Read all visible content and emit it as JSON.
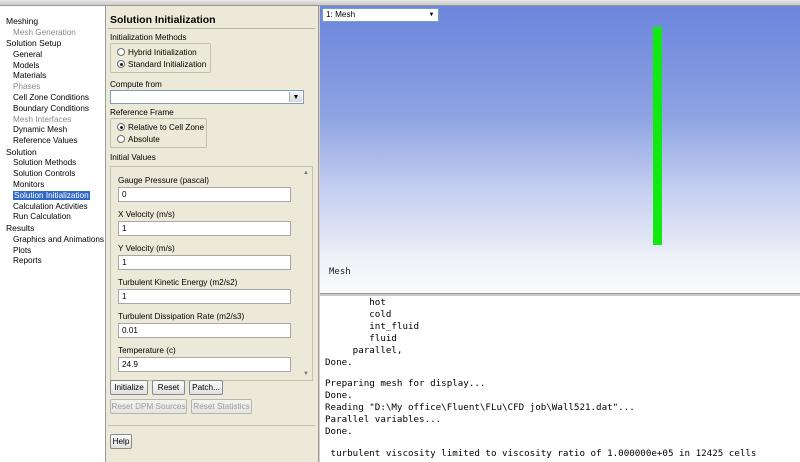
{
  "nav": {
    "sections": [
      {
        "title": "Meshing",
        "items": [
          {
            "label": "Mesh Generation",
            "state": "disabled"
          }
        ]
      },
      {
        "title": "Solution Setup",
        "items": [
          {
            "label": "General",
            "state": "normal"
          },
          {
            "label": "Models",
            "state": "normal"
          },
          {
            "label": "Materials",
            "state": "normal"
          },
          {
            "label": "Phases",
            "state": "disabled"
          },
          {
            "label": "Cell Zone Conditions",
            "state": "normal"
          },
          {
            "label": "Boundary Conditions",
            "state": "normal"
          },
          {
            "label": "Mesh Interfaces",
            "state": "disabled"
          },
          {
            "label": "Dynamic Mesh",
            "state": "normal"
          },
          {
            "label": "Reference Values",
            "state": "normal"
          }
        ]
      },
      {
        "title": "Solution",
        "items": [
          {
            "label": "Solution Methods",
            "state": "normal"
          },
          {
            "label": "Solution Controls",
            "state": "normal"
          },
          {
            "label": "Monitors",
            "state": "normal"
          },
          {
            "label": "Solution Initialization",
            "state": "selected"
          },
          {
            "label": "Calculation Activities",
            "state": "normal"
          },
          {
            "label": "Run Calculation",
            "state": "normal"
          }
        ]
      },
      {
        "title": "Results",
        "items": [
          {
            "label": "Graphics and Animations",
            "state": "normal"
          },
          {
            "label": "Plots",
            "state": "normal"
          },
          {
            "label": "Reports",
            "state": "normal"
          }
        ]
      }
    ]
  },
  "panel": {
    "title": "Solution Initialization",
    "init_methods": {
      "label": "Initialization Methods",
      "options": [
        "Hybrid  Initialization",
        "Standard Initialization"
      ],
      "selected": 1
    },
    "compute_from": {
      "label": "Compute from",
      "value": ""
    },
    "reference_frame": {
      "label": "Reference Frame",
      "options": [
        "Relative to Cell Zone",
        "Absolute"
      ],
      "selected": 0
    },
    "initial_values": {
      "label": "Initial Values",
      "fields": [
        {
          "label": "Gauge Pressure (pascal)",
          "value": "0"
        },
        {
          "label": "X Velocity (m/s)",
          "value": "1"
        },
        {
          "label": "Y Velocity (m/s)",
          "value": "1"
        },
        {
          "label": "Turbulent Kinetic Energy (m2/s2)",
          "value": "1"
        },
        {
          "label": "Turbulent Dissipation Rate (m2/s3)",
          "value": "0.01"
        },
        {
          "label": "Temperature (c)",
          "value": "24.9"
        }
      ]
    },
    "buttons": {
      "initialize": "Initialize",
      "reset": "Reset",
      "patch": "Patch...",
      "reset_dpm": "Reset DPM Sources",
      "reset_stats": "Reset Statistics",
      "help": "Help"
    }
  },
  "graphics": {
    "window_select": "1: Mesh",
    "label": "Mesh",
    "colors": {
      "mesh": "#12e812",
      "bg_top": "#6b85dc",
      "bg_bottom": "#e9ecf7"
    }
  },
  "console": {
    "lines": [
      "        hot",
      "        cold",
      "        int_fluid",
      "        fluid",
      "     parallel,",
      "Done.",
      "",
      "Preparing mesh for display...",
      "Done.",
      "Reading \"D:\\My office\\Fluent\\FLu\\CFD job\\Wall521.dat\"...",
      "Parallel variables...",
      "Done.",
      "",
      " turbulent viscosity limited to viscosity ratio of 1.000000e+05 in 12425 cells"
    ]
  }
}
